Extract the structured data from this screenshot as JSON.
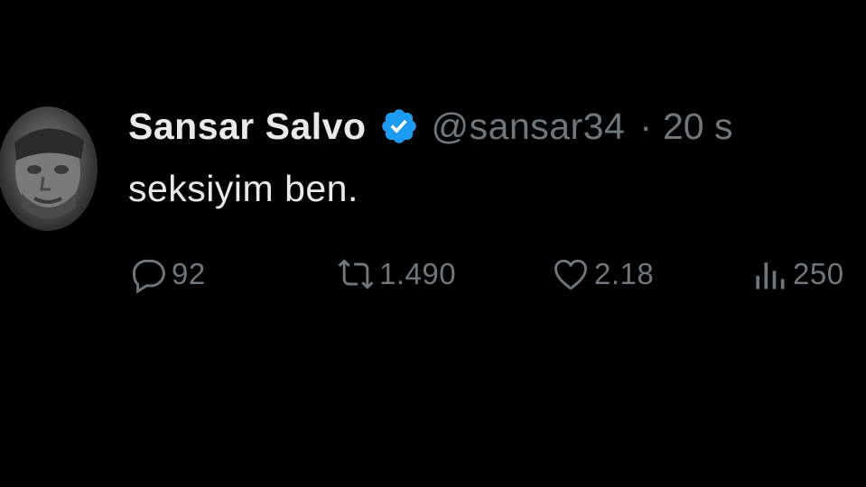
{
  "tweet": {
    "display_name": "Sansar Salvo",
    "handle": "@sansar34",
    "separator": "·",
    "time": "20 s",
    "text": "seksiyim ben.",
    "actions": {
      "reply_count": "92",
      "retweet_count": "1.490",
      "like_count": "2.18",
      "views_count": "250"
    }
  },
  "colors": {
    "background": "#000000",
    "primary_text": "#e7e9ea",
    "secondary_text": "#71767b",
    "verified_badge": "#1d9bf0"
  },
  "icons": {
    "avatar": "profile-photo",
    "verified": "verified-badge-icon",
    "reply": "reply-icon",
    "retweet": "retweet-icon",
    "like": "heart-icon",
    "views": "views-chart-icon"
  }
}
